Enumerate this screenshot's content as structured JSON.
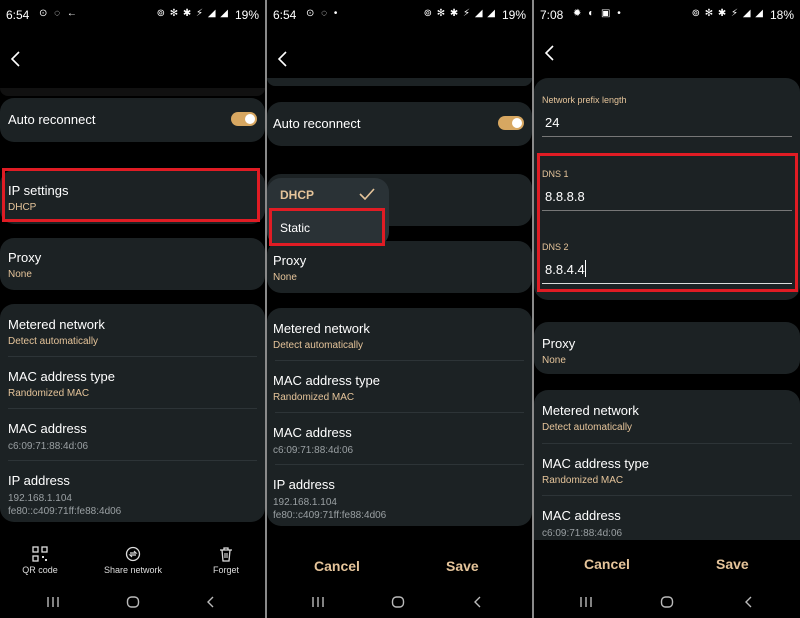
{
  "panel1": {
    "status": {
      "time": "6:54",
      "battery": "19%"
    },
    "auto_reconnect": "Auto reconnect",
    "ip_settings": {
      "title": "IP settings",
      "value": "DHCP"
    },
    "proxy": {
      "title": "Proxy",
      "value": "None"
    },
    "metered": {
      "title": "Metered network",
      "value": "Detect automatically"
    },
    "mac_type": {
      "title": "MAC address type",
      "value": "Randomized MAC"
    },
    "mac": {
      "title": "MAC address",
      "value": "c6:09:71:88:4d:06"
    },
    "ip": {
      "title": "IP address",
      "value1": "192.168.1.104",
      "value2": "fe80::c409:71ff:fe88:4d06"
    },
    "actions": {
      "qr": "QR code",
      "share": "Share network",
      "forget": "Forget"
    }
  },
  "panel2": {
    "status": {
      "time": "6:54",
      "battery": "19%"
    },
    "auto_reconnect": "Auto reconnect",
    "dropdown": {
      "selected": "DHCP",
      "other": "Static"
    },
    "proxy": {
      "title": "Proxy",
      "value": "None"
    },
    "metered": {
      "title": "Metered network",
      "value": "Detect automatically"
    },
    "mac_type": {
      "title": "MAC address type",
      "value": "Randomized MAC"
    },
    "mac": {
      "title": "MAC address",
      "value": "c6:09:71:88:4d:06"
    },
    "ip": {
      "title": "IP address",
      "value1": "192.168.1.104",
      "value2": "fe80::c409:71ff:fe88:4d06"
    },
    "cancel": "Cancel",
    "save": "Save"
  },
  "panel3": {
    "status": {
      "time": "7:08",
      "battery": "18%"
    },
    "prefix": {
      "label": "Network prefix length",
      "value": "24"
    },
    "dns1": {
      "label": "DNS 1",
      "value": "8.8.8.8"
    },
    "dns2": {
      "label": "DNS 2",
      "value": "8.8.4.4"
    },
    "proxy": {
      "title": "Proxy",
      "value": "None"
    },
    "metered": {
      "title": "Metered network",
      "value": "Detect automatically"
    },
    "mac_type": {
      "title": "MAC address type",
      "value": "Randomized MAC"
    },
    "mac": {
      "title": "MAC address",
      "value": "c6:09:71:88:4d:06"
    },
    "cancel": "Cancel",
    "save": "Save"
  },
  "colors": {
    "accent": "#e5c49a",
    "toggle": "#d7a761",
    "highlight": "#e01c24",
    "card": "#1c2224"
  },
  "icons": [
    "back-arrow-icon",
    "qr-code-icon",
    "share-network-icon",
    "trash-icon",
    "checkmark-icon",
    "recents-icon",
    "home-icon",
    "nav-back-icon"
  ]
}
